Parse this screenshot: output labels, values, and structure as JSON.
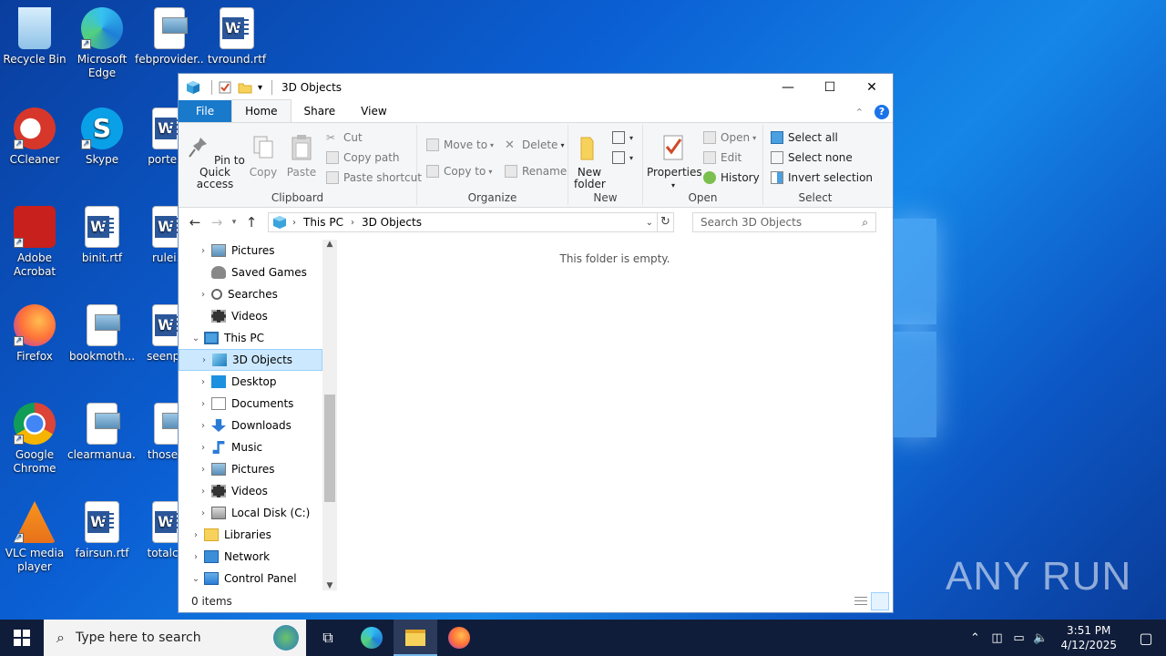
{
  "desktop": {
    "icons": [
      {
        "label": "Recycle Bin"
      },
      {
        "label": "Microsoft Edge"
      },
      {
        "label": "febprovider..."
      },
      {
        "label": "tvround.rtf"
      },
      {
        "label": "CCleaner"
      },
      {
        "label": "Skype"
      },
      {
        "label": "porteith"
      },
      {
        "label": "Adobe Acrobat"
      },
      {
        "label": "binit.rtf"
      },
      {
        "label": "rulei..."
      },
      {
        "label": "Firefox"
      },
      {
        "label": "bookmoth..."
      },
      {
        "label": "seenpas"
      },
      {
        "label": "Google Chrome"
      },
      {
        "label": "clearmanua..."
      },
      {
        "label": "thoseda"
      },
      {
        "label": "VLC media player"
      },
      {
        "label": "fairsun.rtf"
      },
      {
        "label": "totalcha"
      }
    ],
    "watermark": "ANY RUN"
  },
  "window": {
    "title": "3D Objects",
    "controls": {
      "minimize": "—",
      "maximize": "☐",
      "close": "✕"
    },
    "tabs": [
      "File",
      "Home",
      "Share",
      "View"
    ],
    "ribbon": {
      "clipboard": {
        "label": "Clipboard",
        "pin": "Pin to Quick access",
        "copy": "Copy",
        "paste": "Paste",
        "cut": "Cut",
        "copy_path": "Copy path",
        "paste_shortcut": "Paste shortcut"
      },
      "organize": {
        "label": "Organize",
        "move_to": "Move to",
        "copy_to": "Copy to",
        "delete": "Delete",
        "rename": "Rename"
      },
      "new": {
        "label": "New",
        "new_folder": "New folder"
      },
      "open": {
        "label": "Open",
        "properties": "Properties",
        "open": "Open",
        "edit": "Edit",
        "history": "History"
      },
      "select": {
        "label": "Select",
        "select_all": "Select all",
        "select_none": "Select none",
        "invert": "Invert selection"
      }
    },
    "address": {
      "crumbs": [
        "This PC",
        "3D Objects"
      ]
    },
    "search_placeholder": "Search 3D Objects",
    "nav": [
      {
        "label": "Pictures",
        "indent": 1,
        "chev": "›",
        "icon": "pictures"
      },
      {
        "label": "Saved Games",
        "indent": 1,
        "chev": "",
        "icon": "games"
      },
      {
        "label": "Searches",
        "indent": 1,
        "chev": "›",
        "icon": "search"
      },
      {
        "label": "Videos",
        "indent": 1,
        "chev": "",
        "icon": "videos"
      },
      {
        "label": "This PC",
        "indent": 0,
        "chev": "⌄",
        "icon": "pc"
      },
      {
        "label": "3D Objects",
        "indent": 1,
        "chev": "›",
        "icon": "3d",
        "selected": true
      },
      {
        "label": "Desktop",
        "indent": 1,
        "chev": "›",
        "icon": "desktop"
      },
      {
        "label": "Documents",
        "indent": 1,
        "chev": "›",
        "icon": "documents"
      },
      {
        "label": "Downloads",
        "indent": 1,
        "chev": "›",
        "icon": "downloads"
      },
      {
        "label": "Music",
        "indent": 1,
        "chev": "›",
        "icon": "music"
      },
      {
        "label": "Pictures",
        "indent": 1,
        "chev": "›",
        "icon": "pictures"
      },
      {
        "label": "Videos",
        "indent": 1,
        "chev": "›",
        "icon": "videos"
      },
      {
        "label": "Local Disk (C:)",
        "indent": 1,
        "chev": "›",
        "icon": "disk"
      },
      {
        "label": "Libraries",
        "indent": 0,
        "chev": "›",
        "icon": "libraries"
      },
      {
        "label": "Network",
        "indent": 0,
        "chev": "›",
        "icon": "network"
      },
      {
        "label": "Control Panel",
        "indent": 0,
        "chev": "⌄",
        "icon": "control"
      }
    ],
    "empty_message": "This folder is empty.",
    "status": "0 items"
  },
  "taskbar": {
    "search_placeholder": "Type here to search",
    "time": "3:51 PM",
    "date": "4/12/2025"
  }
}
